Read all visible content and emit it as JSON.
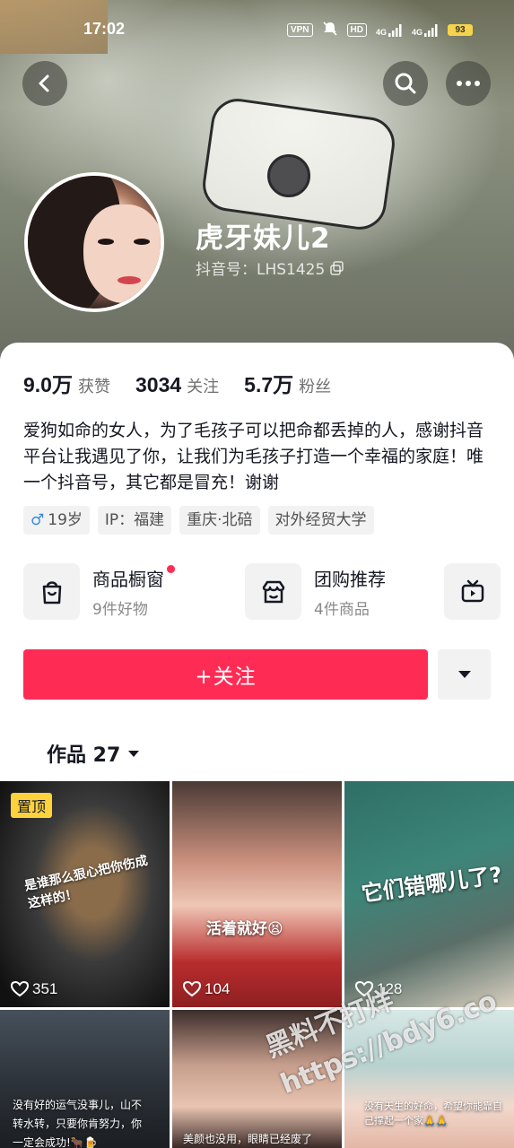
{
  "status_bar": {
    "time": "17:02",
    "vpn": "VPN",
    "hd": "HD",
    "signal1": "4G",
    "signal2": "4G",
    "battery": "93"
  },
  "profile": {
    "name": "虎牙妹儿2",
    "douyin_id": "抖音号：LHS1425"
  },
  "stats": [
    {
      "value": "9.0万",
      "label": "获赞"
    },
    {
      "value": "3034",
      "label": "关注"
    },
    {
      "value": "5.7万",
      "label": "粉丝"
    }
  ],
  "bio": "爱狗如命的女人，为了毛孩子可以把命都丢掉的人，感谢抖音平台让我遇见了你，让我们为毛孩子打造一个幸福的家庭！唯一个抖音号，其它都是冒充！谢谢",
  "tags": [
    "19岁",
    "IP：福建",
    "重庆·北碚",
    "对外经贸大学"
  ],
  "services": [
    {
      "title": "商品橱窗",
      "sub": "9件好物"
    },
    {
      "title": "团购推荐",
      "sub": "4件商品"
    }
  ],
  "follow_label": "+关注",
  "works_tab": "作品 27",
  "videos": [
    {
      "likes": "351",
      "pinned": "置顶",
      "caption": "是谁那么狠心把你伤成这样的！"
    },
    {
      "likes": "104",
      "caption": "活着就好😫"
    },
    {
      "likes": "128",
      "caption": "它们错哪儿了?"
    },
    {
      "caption": "没有好的运气没事儿，山不转水转，只要你肯努力，你一定会成功!🐂🍺"
    },
    {
      "caption": "美颜也没用，眼睛已经废了"
    },
    {
      "caption": "没有天生的好命，希望你能靠自己撑起一个家🙏🙏"
    }
  ],
  "watermark": {
    "line1": "黑料不打烊",
    "line2": "https://bdy6.co"
  },
  "colors": {
    "accent": "#fe2c55",
    "pin": "#fdd23d"
  }
}
